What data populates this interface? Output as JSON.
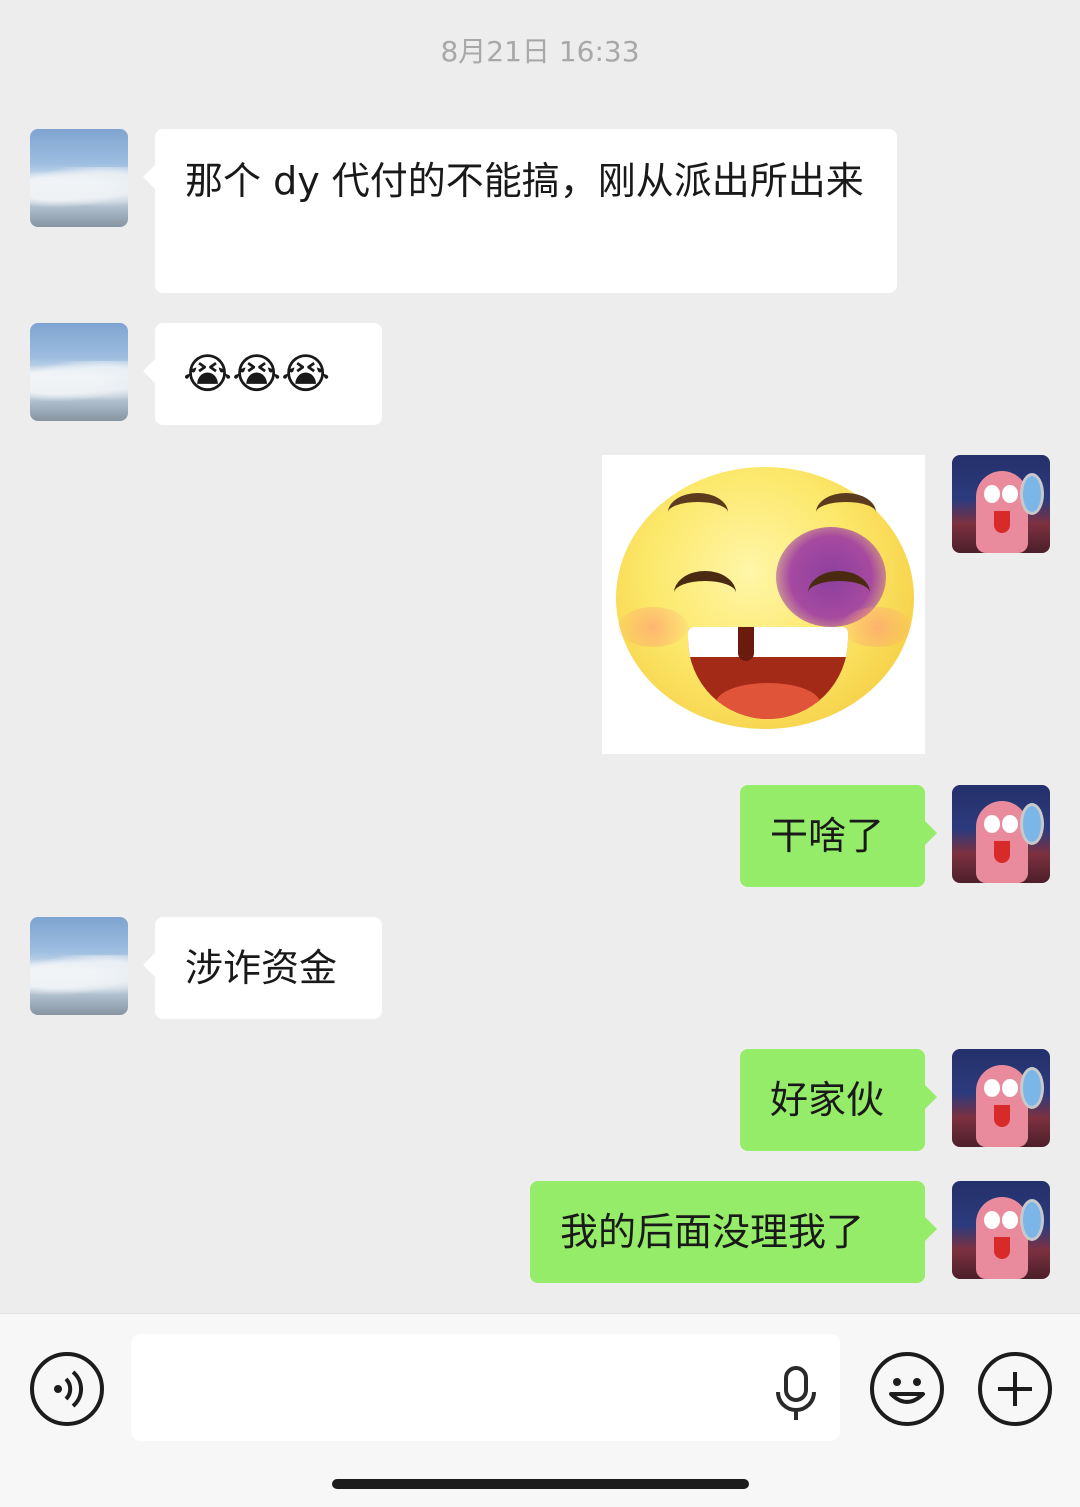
{
  "timestamp": "8月21日 16:33",
  "messages": [
    {
      "side": "in",
      "type": "text",
      "text": "那个 dy 代付的不能搞，刚从派出所出来"
    },
    {
      "side": "in",
      "type": "text",
      "text": "😭😭😭"
    },
    {
      "side": "out",
      "type": "sticker",
      "icon": "smiling-bruised-face-sticker"
    },
    {
      "side": "out",
      "type": "text",
      "text": "干啥了"
    },
    {
      "side": "in",
      "type": "text",
      "text": "涉诈资金"
    },
    {
      "side": "out",
      "type": "text",
      "text": "好家伙"
    },
    {
      "side": "out",
      "type": "text",
      "text": "我的后面没理我了"
    }
  ],
  "input_bar": {
    "placeholder": "",
    "left_icon": "voice-mode-icon",
    "mic_icon": "microphone-icon",
    "emoji_icon": "emoji-icon",
    "plus_icon": "plus-icon"
  },
  "colors": {
    "background": "#ededed",
    "incoming_bubble": "#ffffff",
    "outgoing_bubble": "#95ec69"
  }
}
